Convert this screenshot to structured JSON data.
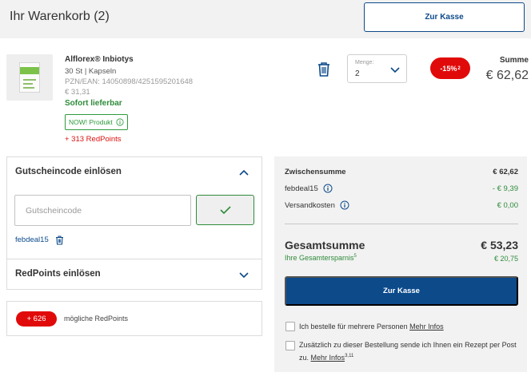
{
  "header": {
    "title": "Ihr Warenkorb (2)",
    "checkout_label": "Zur Kasse"
  },
  "product": {
    "name": "Alflorex® Inbiotys",
    "variant": "30 St | Kapseln",
    "pzn": "PZN/EAN: 14050898/4251595201648",
    "unit_price": "€ 31,31",
    "availability": "Sofort lieferbar",
    "badge": "NOW! Produkt",
    "redpoints": "+ 313 RedPoints",
    "quantity_label": "Menge:",
    "quantity": "2",
    "discount": "-15%",
    "discount_note": "2",
    "total_label": "Summe",
    "total_value": "€ 62,62"
  },
  "coupon": {
    "title": "Gutscheincode einlösen",
    "placeholder": "Gutscheincode",
    "applied_code": "febdeal15"
  },
  "redpoints_panel": {
    "title": "RedPoints einlösen",
    "badge": "+ 626",
    "text": "mögliche RedPoints"
  },
  "summary": {
    "subtotal_label": "Zwischensumme",
    "subtotal_value": "€ 62,62",
    "code_label": "febdeal15",
    "code_value": "- € 9,39",
    "shipping_label": "Versandkosten",
    "shipping_value": "€ 0,00",
    "total_label": "Gesamtsumme",
    "total_value": "€ 53,23",
    "savings_label": "Ihre Gesamtersparnis",
    "savings_note": "5",
    "savings_value": "€ 20,75",
    "checkout_label": "Zur Kasse",
    "option1_text": "Ich bestelle für mehrere Personen",
    "option1_link": "Mehr Infos",
    "option2_text": "Zusätzlich zu dieser Bestellung sende ich Ihnen ein Rezept per Post zu.",
    "option2_link": "Mehr Infos",
    "option2_note": "3,11"
  },
  "colors": {
    "brand_blue": "#0c4a8a",
    "sale_red": "#e10a0a",
    "success_green": "#2e8b3a"
  }
}
